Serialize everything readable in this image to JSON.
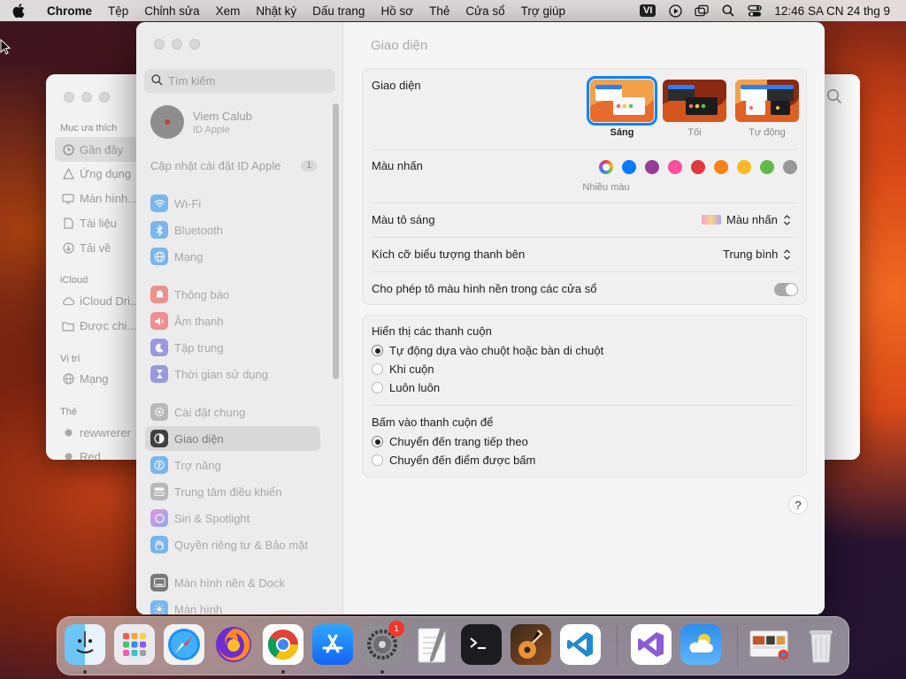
{
  "menubar": {
    "app_name": "Chrome",
    "items": [
      "Tệp",
      "Chỉnh sửa",
      "Xem",
      "Nhật ký",
      "Dấu trang",
      "Hồ sơ",
      "Thẻ",
      "Cửa sổ",
      "Trợ giúp"
    ],
    "input_source": "VI",
    "clock": "12:46 SA CN 24 thg 9"
  },
  "finder": {
    "favorites_label": "Mục ưa thích",
    "favorites": [
      "Gần đây",
      "Ứng dụng",
      "Màn hình...",
      "Tài liệu",
      "Tải về"
    ],
    "icloud_label": "iCloud",
    "icloud": [
      "iCloud Dri...",
      "Được chi..."
    ],
    "locations_label": "Vị trí",
    "locations": [
      "Mạng"
    ],
    "tags_label": "Thẻ",
    "tags": [
      "rewwrerer",
      "Red"
    ]
  },
  "settings": {
    "search_placeholder": "Tìm kiếm",
    "profile": {
      "name": "Viem Calub",
      "subtitle": "ID Apple"
    },
    "update": {
      "label": "Cập nhật cài đặt ID Apple",
      "count": "1"
    },
    "sidebar": {
      "group1": [
        "Wi-Fi",
        "Bluetooth",
        "Mạng"
      ],
      "group2": [
        "Thông báo",
        "Âm thanh",
        "Tập trung",
        "Thời gian sử dụng"
      ],
      "group3": [
        "Cài đặt chung",
        "Giao diện",
        "Trợ năng",
        "Trung tâm điều khiển",
        "Siri & Spotlight",
        "Quyền riêng tư & Bảo mật"
      ],
      "group4": [
        "Màn hình nền & Dock",
        "Màn hình"
      ],
      "selected": "Giao diện"
    },
    "main": {
      "title": "Giao diện",
      "appearance": {
        "label": "Giao diện",
        "options": [
          "Sáng",
          "Tối",
          "Tự động"
        ],
        "selected": "Sáng"
      },
      "accent": {
        "label": "Màu nhấn",
        "caption": "Nhiều màu",
        "colors": [
          "multicolor",
          "#0a7aff",
          "#953d96",
          "#f74f9e",
          "#e0383e",
          "#f7821b",
          "#fcb827",
          "#62ba46",
          "#989898"
        ]
      },
      "highlight": {
        "label": "Màu tô sáng",
        "value": "Màu nhấn"
      },
      "sidebar_icon_size": {
        "label": "Kích cỡ biểu tượng thanh bên",
        "value": "Trung bình"
      },
      "wallpaper_tinting": {
        "label": "Cho phép tô màu hình nền trong các cửa sổ",
        "on": true
      },
      "scrollbars": {
        "label": "Hiển thị các thanh cuộn",
        "options": [
          "Tự động dựa vào chuột hoặc bàn di chuột",
          "Khi cuộn",
          "Luôn luôn"
        ],
        "selected": 0
      },
      "click_scrollbar": {
        "label": "Bấm vào thanh cuộn để",
        "options": [
          "Chuyển đến trang tiếp theo",
          "Chuyển đến điểm được bấm"
        ],
        "selected": 0
      },
      "help": "?"
    }
  },
  "dock": {
    "settings_badge": "1"
  }
}
